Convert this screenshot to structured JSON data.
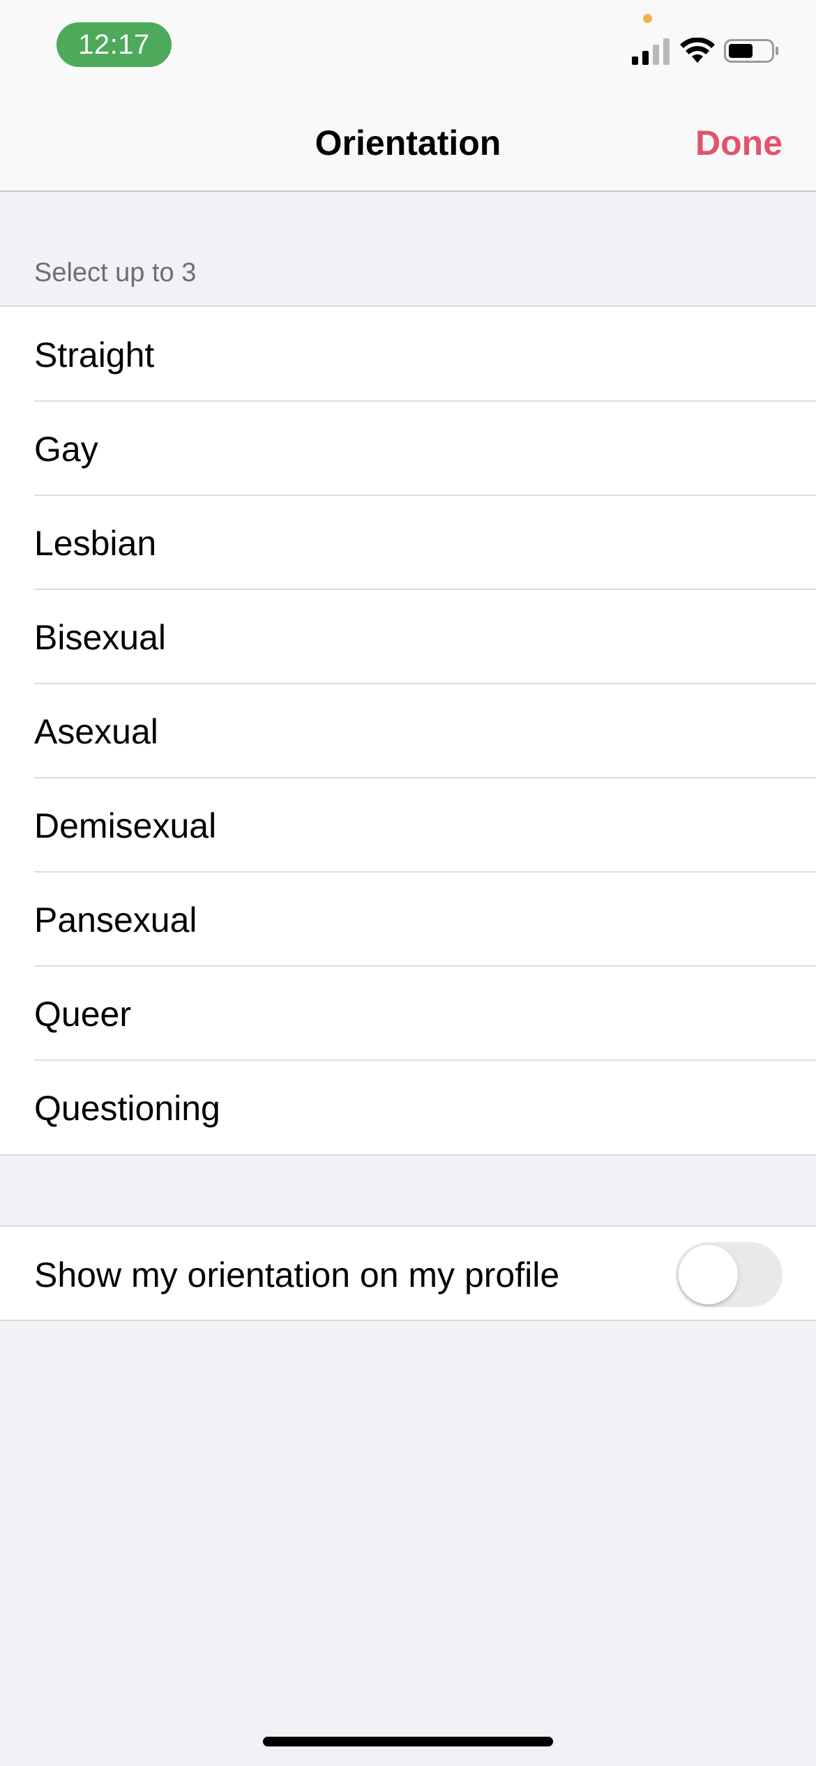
{
  "status_bar": {
    "time": "12:17",
    "icons": [
      "signal-icon",
      "wifi-icon",
      "battery-icon"
    ],
    "time_pill_color": "#4caa5a",
    "privacy_dot_color": "#f0b347"
  },
  "nav": {
    "title": "Orientation",
    "done_label": "Done",
    "accent_color": "#e2536b"
  },
  "section": {
    "header": "Select up to 3"
  },
  "options": [
    {
      "label": "Straight"
    },
    {
      "label": "Gay"
    },
    {
      "label": "Lesbian"
    },
    {
      "label": "Bisexual"
    },
    {
      "label": "Asexual"
    },
    {
      "label": "Demisexual"
    },
    {
      "label": "Pansexual"
    },
    {
      "label": "Queer"
    },
    {
      "label": "Questioning"
    }
  ],
  "visibility": {
    "label": "Show my orientation on my profile",
    "enabled": false
  }
}
